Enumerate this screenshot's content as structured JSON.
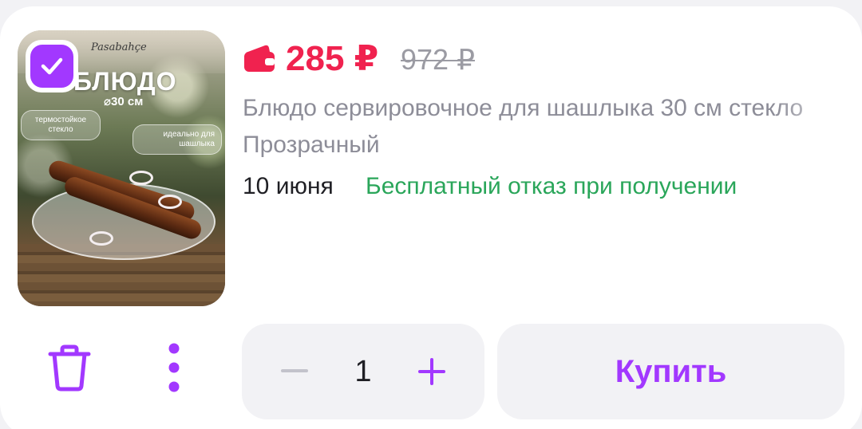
{
  "product": {
    "image": {
      "brand": "Pasabahçe",
      "headline": "БЛЮДО",
      "size": "⌀30 см",
      "chip_left": "термостойкое стекло",
      "chip_right": "идеально для шашлыка"
    },
    "selected": true,
    "price": "285 ₽",
    "old_price": "972 ₽",
    "title": "Блюдо сервировочное для шашлыка 30 см стекло",
    "variant": "Прозрачный",
    "delivery_date": "10 июня",
    "delivery_note": "Бесплатный отказ при получении"
  },
  "actions": {
    "quantity": "1",
    "buy_label": "Купить"
  },
  "icons": {
    "checkbox": "check-icon",
    "wallet": "wallet-icon",
    "trash": "trash-icon",
    "more": "more-vertical-icon",
    "minus": "minus-icon",
    "plus": "plus-icon"
  },
  "colors": {
    "accent": "#a238ff",
    "price": "#f0224f",
    "success": "#2aa65a",
    "muted": "#8d8d98"
  }
}
